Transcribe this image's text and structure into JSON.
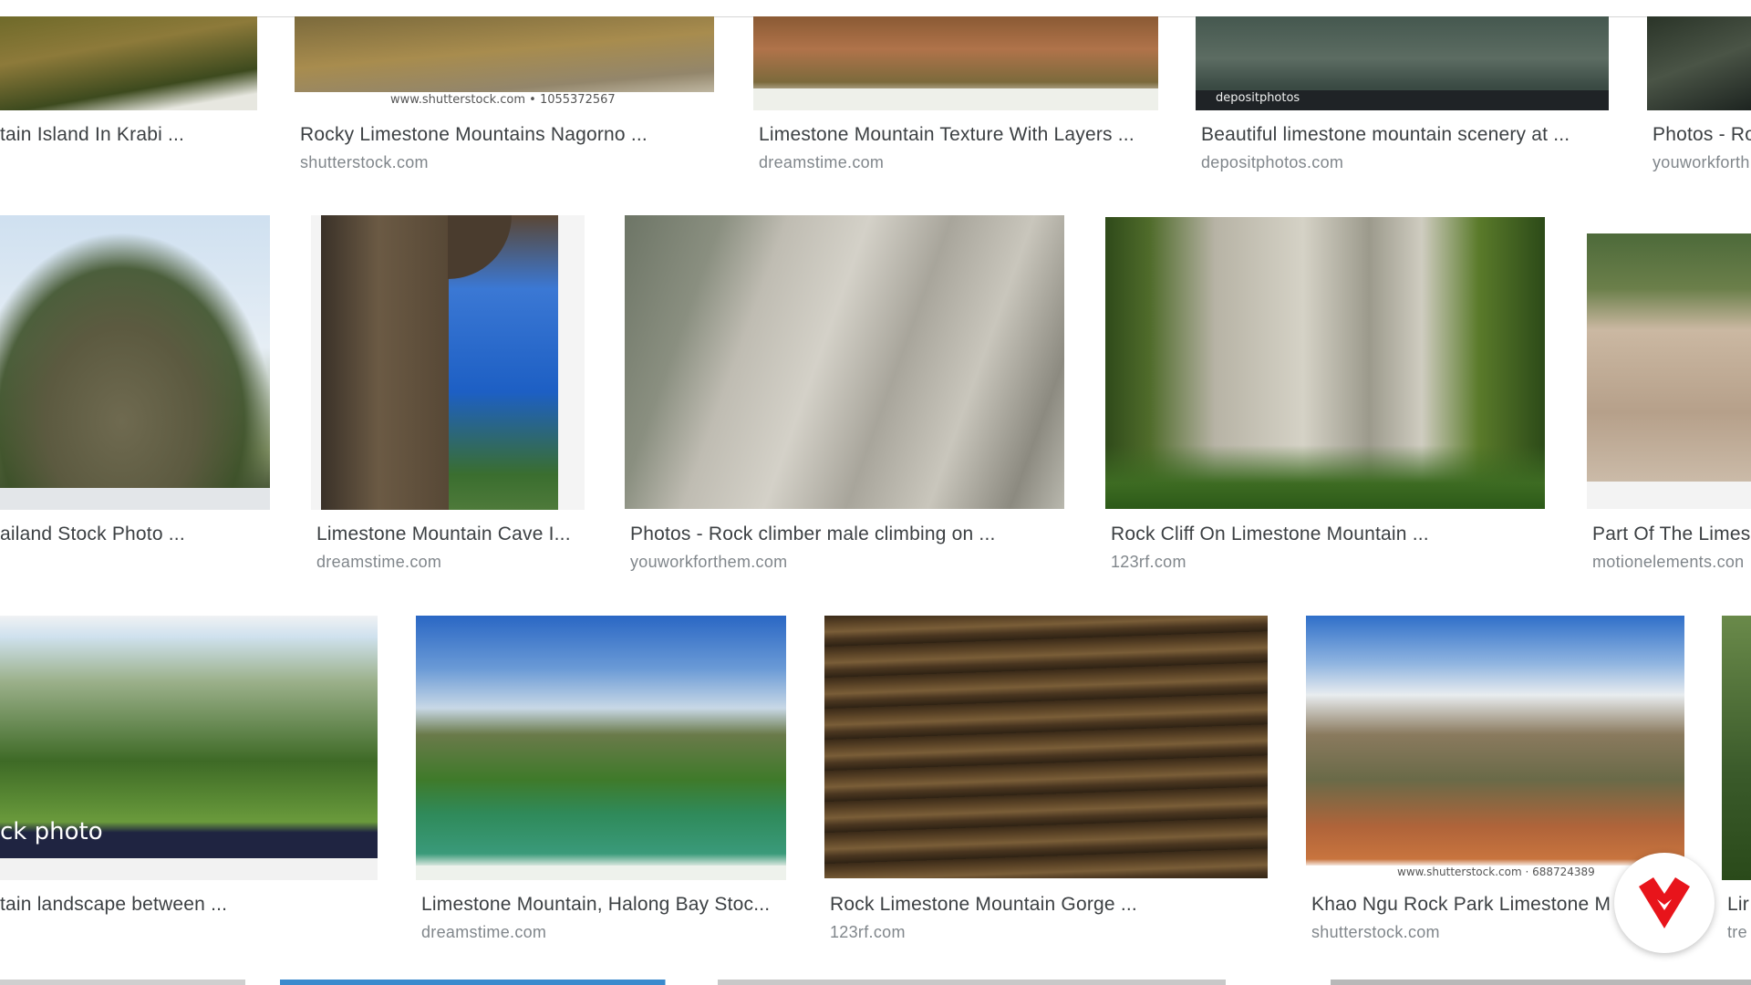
{
  "colors": {
    "title_text": "#3c4043",
    "source_text": "#80868b",
    "fab_accent": "#e8141b"
  },
  "rows": [
    {
      "items": [
        {
          "title": "tain Island In Krabi ...",
          "source": ""
        },
        {
          "title": "Rocky Limestone Mountains Nagorno ...",
          "source": "shutterstock.com",
          "watermark": "www.shutterstock.com • 1055372567"
        },
        {
          "title": "Limestone Mountain Texture With Layers ...",
          "source": "dreamstime.com"
        },
        {
          "title": "Beautiful limestone mountain scenery at ...",
          "source": "depositphotos.com",
          "watermark": "depositphotos"
        },
        {
          "title": "Photos - Ro",
          "source": "youworkforth"
        }
      ]
    },
    {
      "items": [
        {
          "title": "ailand Stock Photo ...",
          "source": ""
        },
        {
          "title": "Limestone Mountain Cave I...",
          "source": "dreamstime.com"
        },
        {
          "title": "Photos - Rock climber male climbing on ...",
          "source": "youworkforthem.com"
        },
        {
          "title": "Rock Cliff On Limestone Mountain ...",
          "source": "123rf.com"
        },
        {
          "title": "Part Of The Limes",
          "source": "motionelements.con"
        }
      ]
    },
    {
      "items": [
        {
          "title": "tain landscape between ...",
          "source": "",
          "watermark": "ck photo"
        },
        {
          "title": "Limestone Mountain, Halong Bay Stoc...",
          "source": "dreamstime.com"
        },
        {
          "title": "Rock Limestone Mountain Gorge ...",
          "source": "123rf.com"
        },
        {
          "title": "Khao Ngu Rock Park Limestone M",
          "source": "shutterstock.com",
          "watermark": "www.shutterstock.com · 688724389"
        },
        {
          "title": "Lir",
          "source": "tre"
        }
      ]
    }
  ]
}
